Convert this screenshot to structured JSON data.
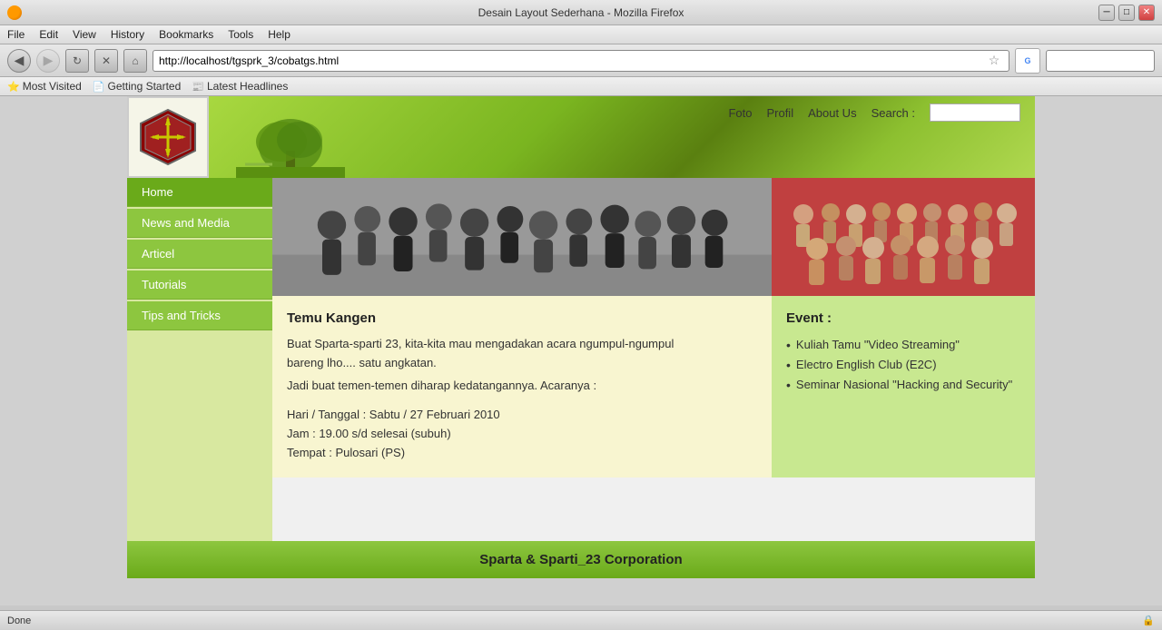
{
  "browser": {
    "title": "Desain Layout Sederhana - Mozilla Firefox",
    "url": "http://localhost/tgsprk_3/cobatgs.html",
    "menu_items": [
      "File",
      "Edit",
      "View",
      "History",
      "Bookmarks",
      "Tools",
      "Help"
    ],
    "bookmarks": [
      "Most Visited",
      "Getting Started",
      "Latest Headlines"
    ],
    "search_placeholder": "Google",
    "status": "Done"
  },
  "header": {
    "nav_links": [
      "Foto",
      "Profil",
      "About Us"
    ],
    "search_label": "Search :",
    "search_placeholder": ""
  },
  "sidebar": {
    "items": [
      {
        "label": "Home",
        "active": true
      },
      {
        "label": "News and Media",
        "active": false
      },
      {
        "label": "Articel",
        "active": false
      },
      {
        "label": "Tutorials",
        "active": false
      },
      {
        "label": "Tips and Tricks",
        "active": false
      }
    ]
  },
  "article": {
    "title": "Temu Kangen",
    "body_line1": "Buat Sparta-sparti 23, kita-kita mau mengadakan acara ngumpul-ngumpul",
    "body_line2": "bareng lho.... satu angkatan.",
    "body_line3": "Jadi buat temen-temen diharap kedatangannya. Acaranya :",
    "body_line4": "",
    "body_line5": "Hari / Tanggal : Sabtu / 27 Februari 2010",
    "body_line6": "Jam : 19.00 s/d selesai (subuh)",
    "body_line7": "Tempat : Pulosari (PS)"
  },
  "events": {
    "title": "Event :",
    "items": [
      "Kuliah Tamu \"Video Streaming\"",
      "Electro English Club (E2C)",
      "Seminar Nasional \"Hacking and Security\""
    ]
  },
  "footer": {
    "text": "Sparta & Sparti_23 Corporation"
  }
}
